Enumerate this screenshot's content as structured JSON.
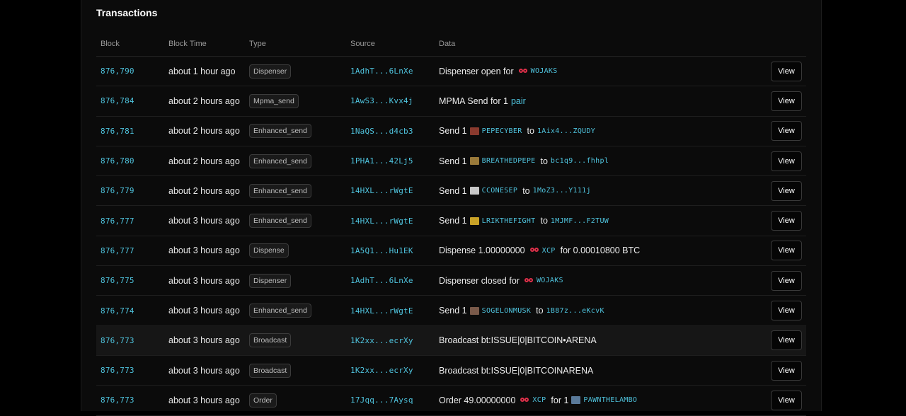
{
  "section_title": "Transactions",
  "columns": {
    "block": "Block",
    "block_time": "Block Time",
    "type": "Type",
    "source": "Source",
    "data": "Data"
  },
  "view_label": "View",
  "rows": [
    {
      "block": "876,790",
      "time": "about 1 hour ago",
      "type": "Dispenser",
      "source": "1AdhT...6LnXe",
      "d1": "Dispenser open for",
      "asset": "WOJAKS"
    },
    {
      "block": "876,784",
      "time": "about 2 hours ago",
      "type": "Mpma_send",
      "source": "1AwS3...Kvx4j",
      "d1": "MPMA Send for 1",
      "link": "pair"
    },
    {
      "block": "876,781",
      "time": "about 2 hours ago",
      "type": "Enhanced_send",
      "source": "1NaQS...d4cb3",
      "d1": "Send 1",
      "asset": "PEPECYBER",
      "to": "to",
      "dest": "1Aix4...ZQUDY",
      "icon_color": "#8a3a2e"
    },
    {
      "block": "876,780",
      "time": "about 2 hours ago",
      "type": "Enhanced_send",
      "source": "1PHA1...42Lj5",
      "d1": "Send 1",
      "asset": "BREATHEDPEPE",
      "to": "to",
      "dest": "bc1q9...fhhpl",
      "icon_color": "#9a7a3a"
    },
    {
      "block": "876,779",
      "time": "about 2 hours ago",
      "type": "Enhanced_send",
      "source": "14HXL...rWgtE",
      "d1": "Send 1",
      "asset": "CCONESEP",
      "to": "to",
      "dest": "1MoZ3...Y111j",
      "icon_color": "#c8c8c8"
    },
    {
      "block": "876,777",
      "time": "about 3 hours ago",
      "type": "Enhanced_send",
      "source": "14HXL...rWgtE",
      "d1": "Send 1",
      "asset": "LRIKTHEFIGHT",
      "to": "to",
      "dest": "1MJMF...F2TUW",
      "icon_color": "#c9a227"
    },
    {
      "block": "876,777",
      "time": "about 3 hours ago",
      "type": "Dispense",
      "source": "1A5Q1...Hu1EK",
      "d1": "Dispense 1.00000000",
      "asset": "XCP",
      "d2": "for 0.00010800 BTC"
    },
    {
      "block": "876,775",
      "time": "about 3 hours ago",
      "type": "Dispenser",
      "source": "1AdhT...6LnXe",
      "d1": "Dispenser closed for",
      "asset": "WOJAKS"
    },
    {
      "block": "876,774",
      "time": "about 3 hours ago",
      "type": "Enhanced_send",
      "source": "14HXL...rWgtE",
      "d1": "Send 1",
      "asset": "SOGELONMUSK",
      "to": "to",
      "dest": "1B87z...eKcvK",
      "icon_color": "#7a5a4a"
    },
    {
      "block": "876,773",
      "time": "about 3 hours ago",
      "type": "Broadcast",
      "source": "1K2xx...ecrXy",
      "d1": "Broadcast bt:ISSUE|0|BITCOIN•ARENA"
    },
    {
      "block": "876,773",
      "time": "about 3 hours ago",
      "type": "Broadcast",
      "source": "1K2xx...ecrXy",
      "d1": "Broadcast bt:ISSUE|0|BITCOINARENA"
    },
    {
      "block": "876,773",
      "time": "about 3 hours ago",
      "type": "Order",
      "source": "17Jqq...7Aysq",
      "d1": "Order 49.00000000",
      "asset": "XCP",
      "d2": "for 1",
      "asset2": "PAWNTHELAMBO",
      "icon_color": "#5a7a9a"
    }
  ]
}
